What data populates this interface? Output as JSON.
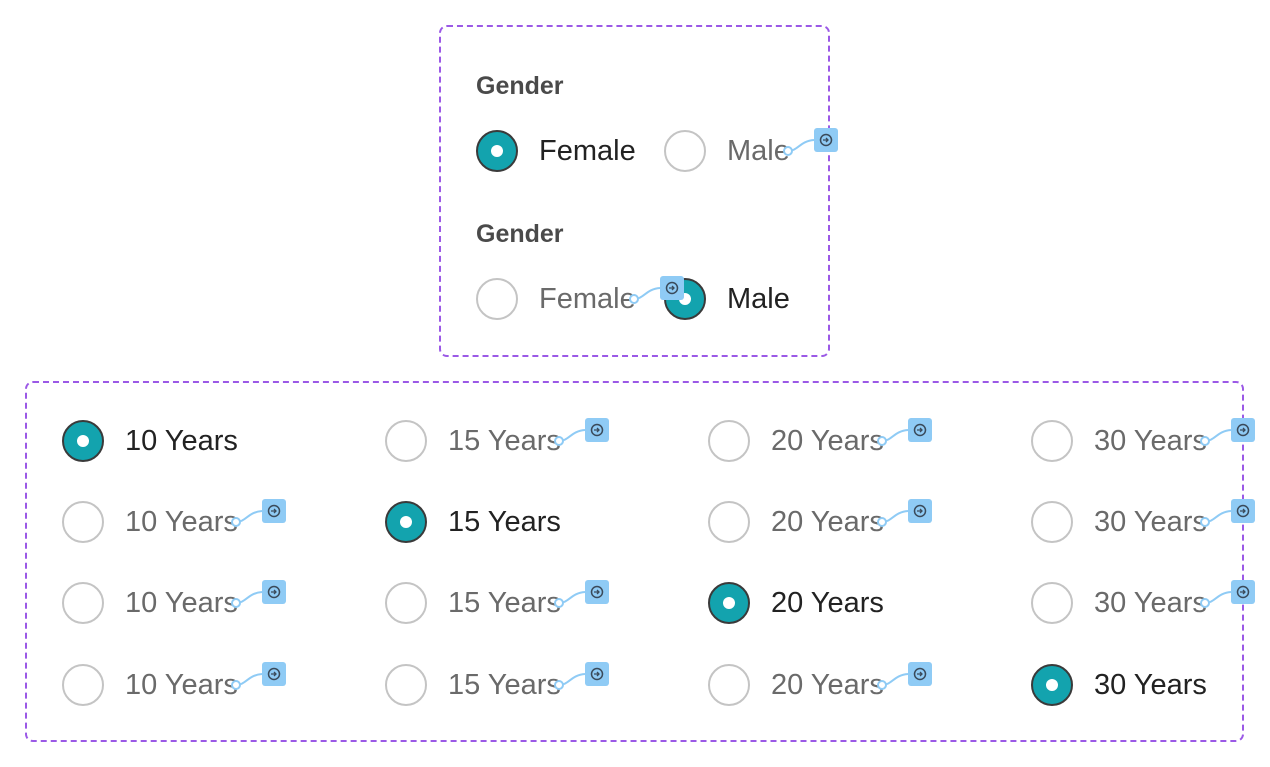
{
  "gender_groups": [
    {
      "label": "Gender",
      "options": [
        {
          "label": "Female",
          "checked": true
        },
        {
          "label": "Male",
          "checked": false
        }
      ]
    },
    {
      "label": "Gender",
      "options": [
        {
          "label": "Female",
          "checked": false
        },
        {
          "label": "Male",
          "checked": true
        }
      ]
    }
  ],
  "years_rows": [
    {
      "options": [
        {
          "label": "10 Years",
          "checked": true
        },
        {
          "label": "15 Years",
          "checked": false
        },
        {
          "label": "20 Years",
          "checked": false
        },
        {
          "label": "30 Years",
          "checked": false
        }
      ]
    },
    {
      "options": [
        {
          "label": "10 Years",
          "checked": false
        },
        {
          "label": "15 Years",
          "checked": true
        },
        {
          "label": "20 Years",
          "checked": false
        },
        {
          "label": "30 Years",
          "checked": false
        }
      ]
    },
    {
      "options": [
        {
          "label": "10 Years",
          "checked": false
        },
        {
          "label": "15 Years",
          "checked": false
        },
        {
          "label": "20 Years",
          "checked": true
        },
        {
          "label": "30 Years",
          "checked": false
        }
      ]
    },
    {
      "options": [
        {
          "label": "10 Years",
          "checked": false
        },
        {
          "label": "15 Years",
          "checked": false
        },
        {
          "label": "20 Years",
          "checked": false
        },
        {
          "label": "30 Years",
          "checked": true
        }
      ]
    }
  ],
  "colors": {
    "accent": "#13a3ae",
    "frame_dashed": "#9b59e6",
    "connector": "#8fcbf5",
    "unchecked_border": "#c4c4c4"
  },
  "icons": {
    "connector": "component-link-icon"
  }
}
